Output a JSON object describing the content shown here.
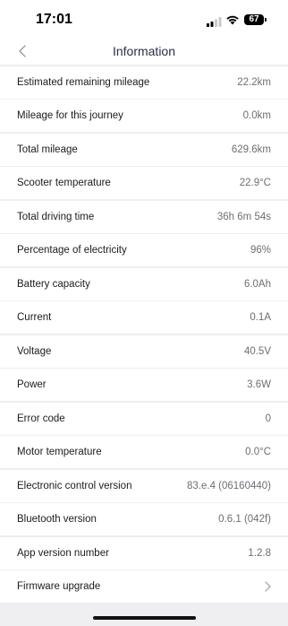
{
  "status": {
    "time": "17:01",
    "battery": "67"
  },
  "nav": {
    "title": "Information"
  },
  "rows": [
    {
      "label": "Estimated remaining mileage",
      "value": "22.2km"
    },
    {
      "label": "Mileage for this journey",
      "value": "0.0km"
    },
    {
      "label": "Total mileage",
      "value": "629.6km"
    },
    {
      "label": "Scooter temperature",
      "value": "22.9°C"
    },
    {
      "label": "Total driving time",
      "value": "36h 6m 54s"
    },
    {
      "label": "Percentage of electricity",
      "value": "96%"
    },
    {
      "label": "Battery capacity",
      "value": "6.0Ah"
    },
    {
      "label": "Current",
      "value": "0.1A"
    },
    {
      "label": "Voltage",
      "value": "40.5V"
    },
    {
      "label": "Power",
      "value": "3.6W"
    },
    {
      "label": "Error code",
      "value": "0"
    },
    {
      "label": "Motor temperature",
      "value": "0.0°C"
    },
    {
      "label": "Electronic control version",
      "value": "83.e.4 (06160440)"
    },
    {
      "label": "Bluetooth version",
      "value": "0.6.1 (042f)"
    },
    {
      "label": "App version number",
      "value": "1.2.8"
    },
    {
      "label": "Firmware upgrade"
    }
  ]
}
